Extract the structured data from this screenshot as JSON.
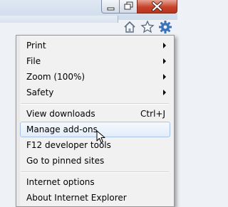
{
  "window": {
    "colors": {
      "close_button": "#c7432a",
      "menu_background": "#f1f1f1",
      "highlight_border": "#a8c5e8"
    }
  },
  "toolbar": {
    "icons": [
      "minimize-icon",
      "maximize-icon",
      "close-icon",
      "home-icon",
      "star-icon",
      "gear-icon"
    ]
  },
  "menu": {
    "items": [
      {
        "label": "Print",
        "has_submenu": true
      },
      {
        "label": "File",
        "has_submenu": true
      },
      {
        "label": "Zoom (100%)",
        "has_submenu": true
      },
      {
        "label": "Safety",
        "has_submenu": true
      },
      {
        "label": "View downloads",
        "shortcut": "Ctrl+J"
      },
      {
        "label": "Manage add-ons",
        "highlighted": true
      },
      {
        "label": "F12 developer tools"
      },
      {
        "label": "Go to pinned sites"
      },
      {
        "label": "Internet options"
      },
      {
        "label": "About Internet Explorer"
      }
    ]
  }
}
